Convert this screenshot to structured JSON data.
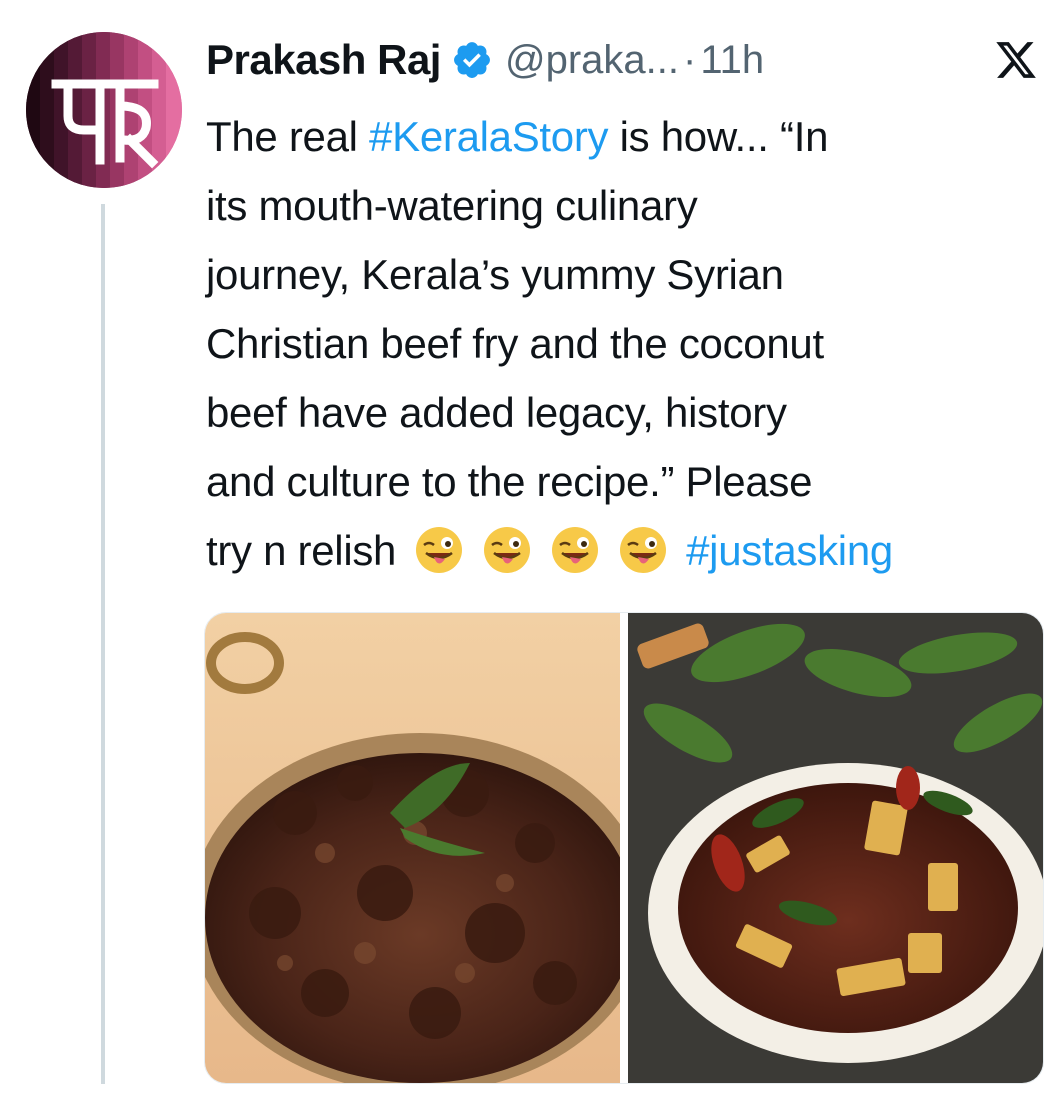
{
  "author": {
    "name": "Prakash Raj",
    "handle": "@praka...",
    "time_separator": "·",
    "time": "11h",
    "avatar_glyph": "पR",
    "verified_icon": "verified-badge-icon"
  },
  "platform_icon": "x-logo-icon",
  "tweet": {
    "line1": {
      "pre": "The real ",
      "hashtag": "#KeralaStory",
      "post": " is how... “In"
    },
    "line2": "its mouth-watering culinary",
    "line3": "journey, Kerala’s yummy Syrian",
    "line4": "Christian beef fry and the coconut",
    "line5": "beef have added legacy, history",
    "line6": "and culture to the recipe.” Please",
    "line7": {
      "pre": "try n relish",
      "emojis": [
        "😜",
        "😜",
        "😜",
        "😜"
      ],
      "hashtag": "#justasking"
    }
  },
  "media": [
    {
      "name": "beef-fry-in-pan-photo"
    },
    {
      "name": "coconut-beef-plate-photo"
    }
  ],
  "colors": {
    "link": "#1d9bf0",
    "secondary": "#536471",
    "verified": "#1d9bf0"
  }
}
